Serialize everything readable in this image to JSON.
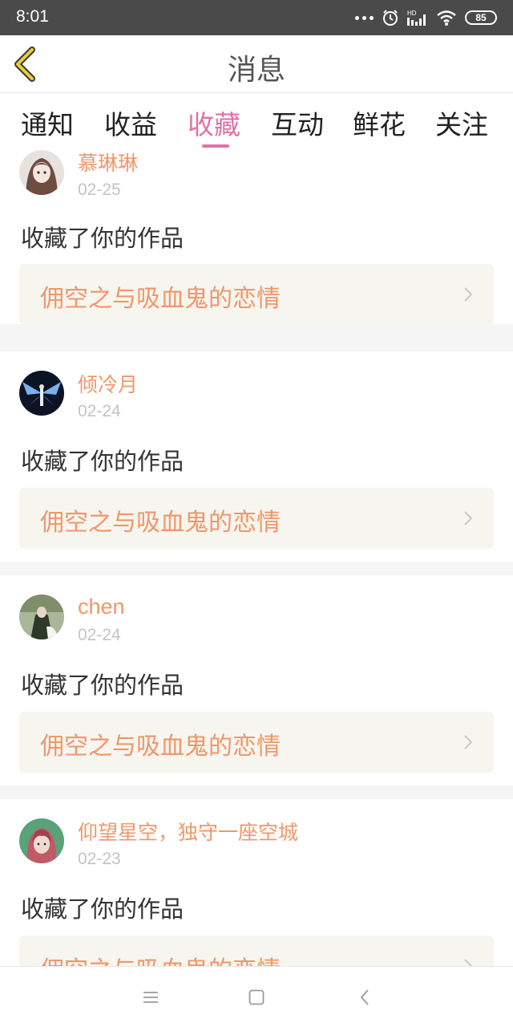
{
  "status_bar": {
    "time": "8:01",
    "battery": "85"
  },
  "header": {
    "title": "消息"
  },
  "tabs": [
    {
      "label": "通知",
      "active": false
    },
    {
      "label": "收益",
      "active": false
    },
    {
      "label": "收藏",
      "active": true
    },
    {
      "label": "互动",
      "active": false
    },
    {
      "label": "鲜花",
      "active": false
    },
    {
      "label": "关注",
      "active": false
    }
  ],
  "colors": {
    "accent_pink": "#e072a6",
    "accent_orange": "#f0976a",
    "status_bar": "#4a4a4a"
  },
  "items": [
    {
      "user": "慕琳琳",
      "date": "02-25",
      "action": "收藏了你的作品",
      "work": "佣空之与吸血鬼的恋情"
    },
    {
      "user": "倾冷月",
      "date": "02-24",
      "action": "收藏了你的作品",
      "work": "佣空之与吸血鬼的恋情"
    },
    {
      "user": "chen",
      "date": "02-24",
      "action": "收藏了你的作品",
      "work": "佣空之与吸血鬼的恋情"
    },
    {
      "user": "仰望星空，独守一座空城",
      "date": "02-23",
      "action": "收藏了你的作品",
      "work": "佣空之与吸血鬼的恋情"
    }
  ]
}
